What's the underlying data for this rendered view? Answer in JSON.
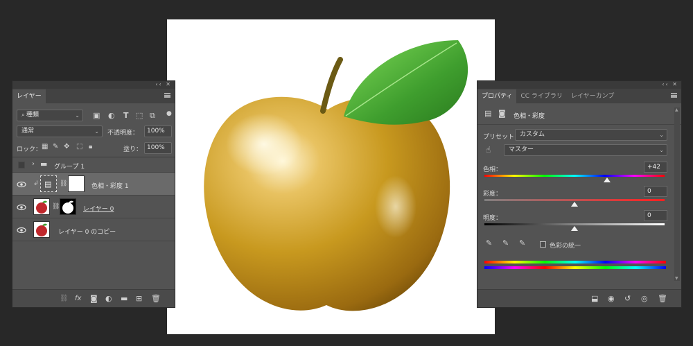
{
  "layers_panel": {
    "tab": "レイヤー",
    "filter_kind": "種類",
    "blend_mode": "通常",
    "opacity_label": "不透明度：",
    "opacity_value": "100%",
    "lock_label": "ロック：",
    "fill_label": "塗り：",
    "fill_value": "100%",
    "layers": [
      {
        "name": "グループ 1",
        "type": "group"
      },
      {
        "name": "色相・彩度 1",
        "type": "adjustment"
      },
      {
        "name": "レイヤー 0",
        "type": "pixel-masked"
      },
      {
        "name": "レイヤー 0 のコピー",
        "type": "pixel"
      }
    ]
  },
  "properties_panel": {
    "tabs": [
      "プロパティ",
      "CC ライブラリ",
      "レイヤーカンプ"
    ],
    "title": "色相・彩度",
    "preset_label": "プリセット：",
    "preset_value": "カスタム",
    "channel_value": "マスター",
    "hue_label": "色相：",
    "hue_value": "+42",
    "saturation_label": "彩度：",
    "saturation_value": "0",
    "lightness_label": "明度：",
    "lightness_value": "0",
    "colorize_label": "色彩の統一",
    "hue_level": 0.68,
    "saturation_level": 0.5,
    "lightness_level": 0.5
  },
  "colors": {
    "apple": "#c8991f",
    "leaf": "#3f9e2e",
    "panel": "#535353",
    "app_bg": "#282828"
  }
}
